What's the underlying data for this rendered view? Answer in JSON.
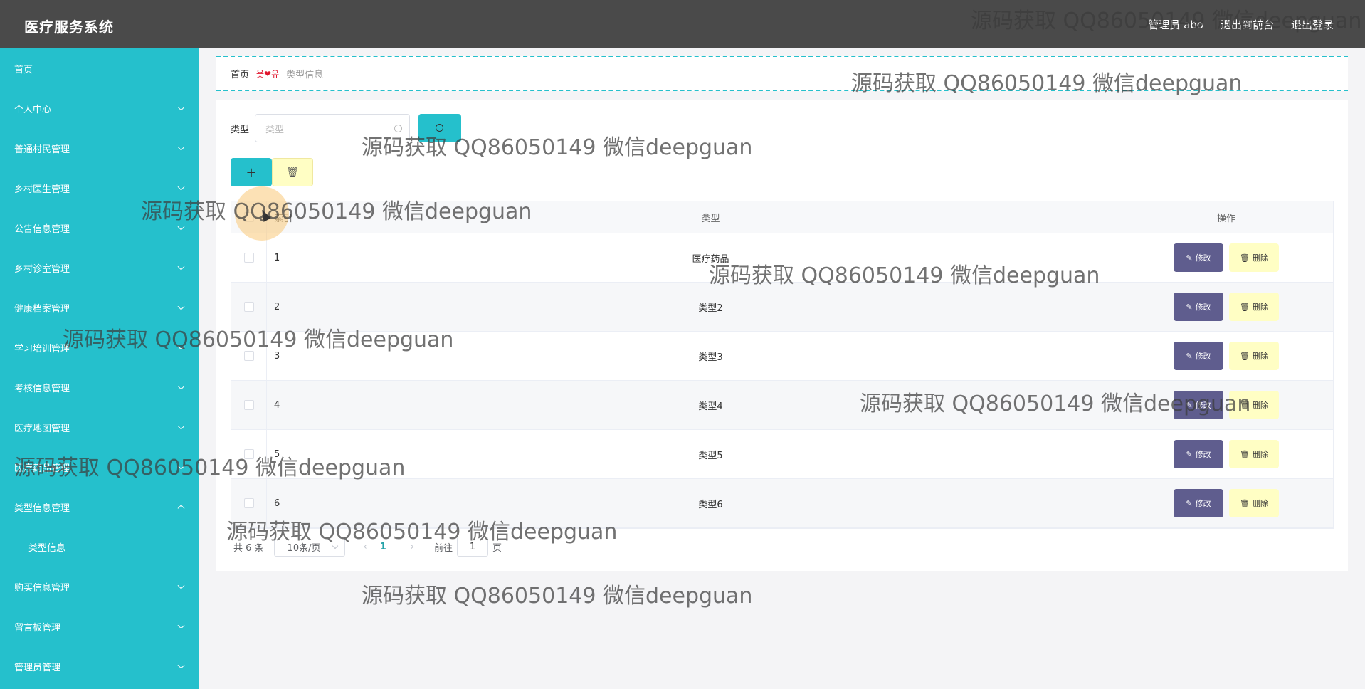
{
  "header": {
    "title": "医疗服务系统",
    "user_label": "管理员 abo",
    "to_front": "退出到前台",
    "logout": "退出登录"
  },
  "sidebar": {
    "items": [
      {
        "label": "首页",
        "chevron": "none"
      },
      {
        "label": "个人中心",
        "chevron": "down"
      },
      {
        "label": "普通村民管理",
        "chevron": "down"
      },
      {
        "label": "乡村医生管理",
        "chevron": "down"
      },
      {
        "label": "公告信息管理",
        "chevron": "down"
      },
      {
        "label": "乡村诊室管理",
        "chevron": "down"
      },
      {
        "label": "健康档案管理",
        "chevron": "down"
      },
      {
        "label": "学习培训管理",
        "chevron": "down"
      },
      {
        "label": "考核信息管理",
        "chevron": "down"
      },
      {
        "label": "医疗地图管理",
        "chevron": "down"
      },
      {
        "label": "医疗药品管理",
        "chevron": "down"
      },
      {
        "label": "类型信息管理",
        "chevron": "up"
      },
      {
        "label": "类型信息",
        "chevron": "none"
      },
      {
        "label": "购买信息管理",
        "chevron": "down"
      },
      {
        "label": "留言板管理",
        "chevron": "down"
      },
      {
        "label": "管理员管理",
        "chevron": "down"
      }
    ]
  },
  "breadcrumb": {
    "home": "首页",
    "separator": "웃❤유",
    "current": "类型信息"
  },
  "search": {
    "label": "类型",
    "placeholder": "类型"
  },
  "table": {
    "headers": {
      "index": "索引",
      "type": "类型",
      "actions": "操作"
    },
    "rows": [
      {
        "index": "1",
        "type": "医疗药品"
      },
      {
        "index": "2",
        "type": "类型2"
      },
      {
        "index": "3",
        "type": "类型3"
      },
      {
        "index": "4",
        "type": "类型4"
      },
      {
        "index": "5",
        "type": "类型5"
      },
      {
        "index": "6",
        "type": "类型6"
      }
    ],
    "edit_label": "修改",
    "delete_label": "删除"
  },
  "pagination": {
    "total": "共 6 条",
    "page_size": "10条/页",
    "current_page": "1",
    "goto_prefix": "前往",
    "goto_value": "1",
    "goto_suffix": "页"
  },
  "watermark": "源码获取 QQ86050149 微信deepguan",
  "colors": {
    "accent": "#25c0cc",
    "header_bg": "#4a4a4a",
    "edit_button": "#5f5d8e",
    "delete_button": "#fffec4"
  }
}
